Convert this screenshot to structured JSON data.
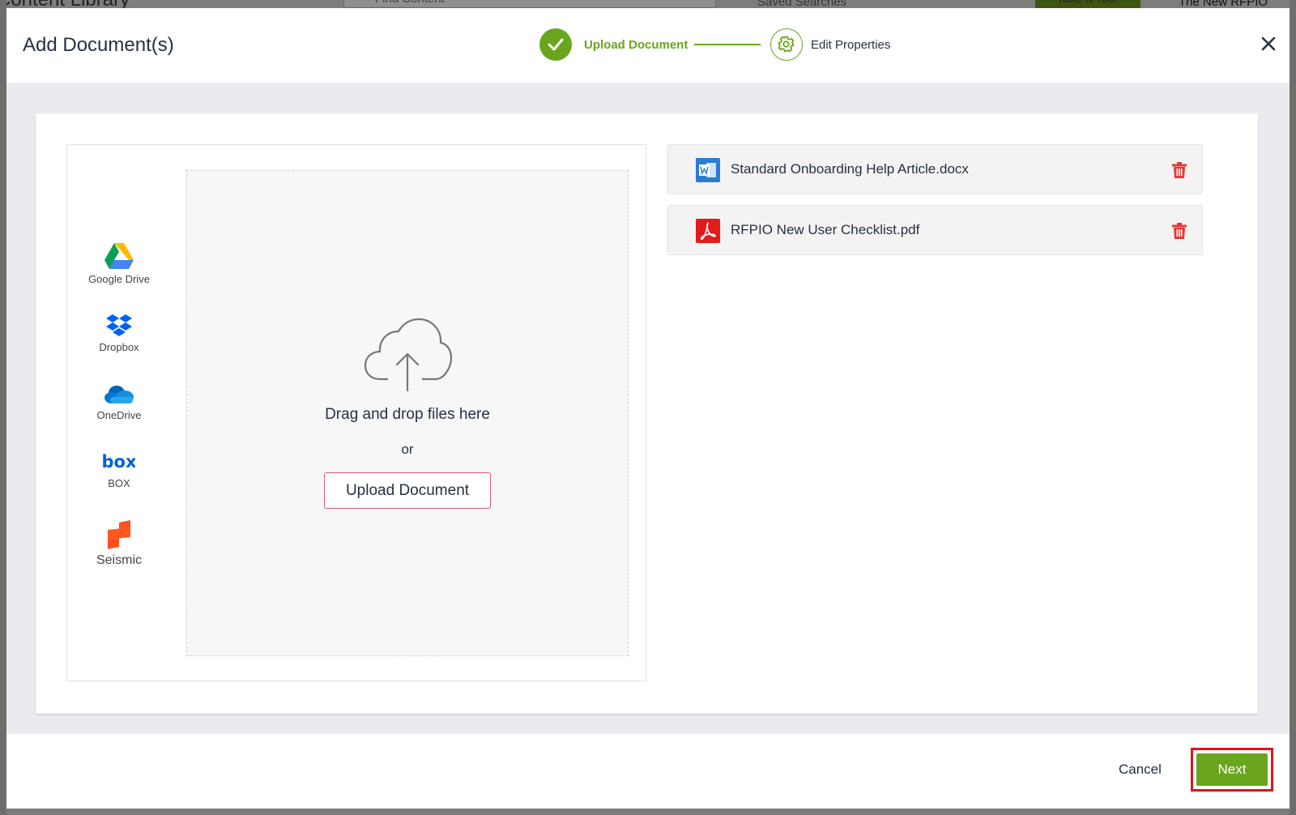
{
  "background": {
    "title": "Content Library",
    "search_placeholder": "Find Content",
    "saved_searches": "Saved Searches",
    "tour_button": "Take a Tour",
    "new_label": "The New RFPIO"
  },
  "modal": {
    "title": "Add Document(s)",
    "steps": [
      {
        "label": "Upload Document",
        "state": "complete"
      },
      {
        "label": "Edit Properties",
        "state": "pending"
      }
    ],
    "sources": [
      {
        "label": "Google Drive",
        "icon": "google-drive-icon"
      },
      {
        "label": "Dropbox",
        "icon": "dropbox-icon"
      },
      {
        "label": "OneDrive",
        "icon": "onedrive-icon"
      },
      {
        "label": "BOX",
        "icon": "box-icon"
      },
      {
        "label": "Seismic",
        "icon": "seismic-icon"
      }
    ],
    "dropzone": {
      "drag_text": "Drag and drop files here",
      "or_text": "or",
      "upload_button": "Upload Document"
    },
    "files": [
      {
        "name": "Standard Onboarding Help Article.docx",
        "type": "word"
      },
      {
        "name": "RFPIO New User Checklist.pdf",
        "type": "pdf"
      }
    ],
    "footer": {
      "cancel": "Cancel",
      "next": "Next"
    }
  },
  "colors": {
    "accent": "#6aa51e",
    "text": "#273041",
    "danger": "#e53935",
    "highlight": "#e2121a"
  }
}
